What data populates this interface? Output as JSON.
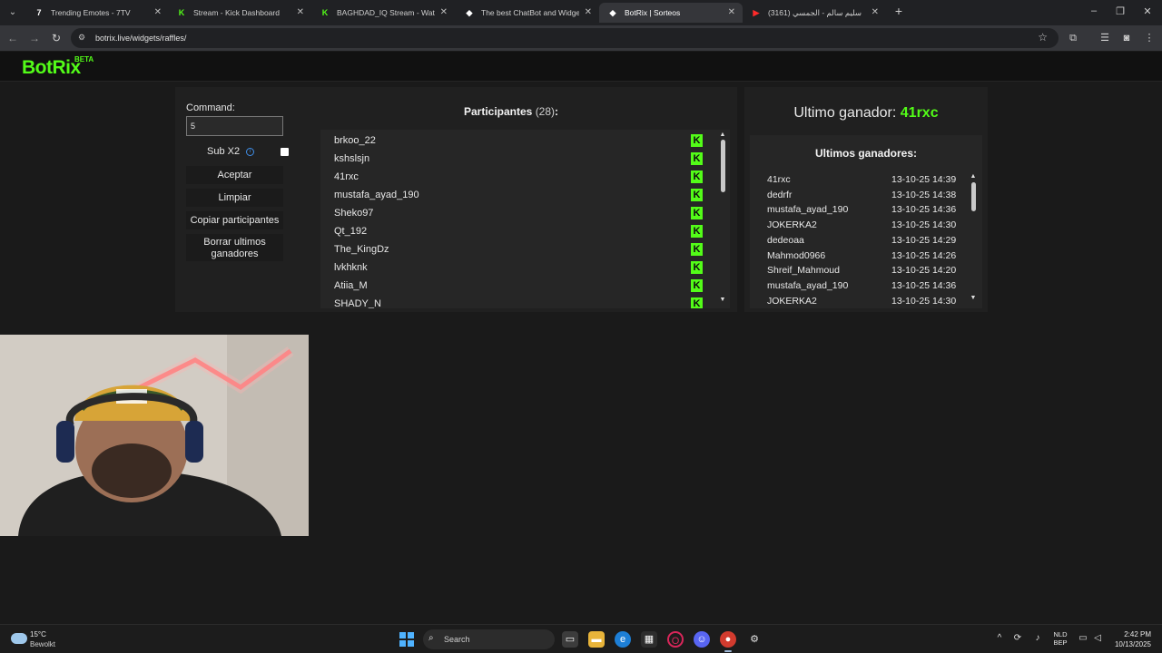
{
  "browser": {
    "tabs": [
      {
        "label": "Trending Emotes - 7TV",
        "icon": "7tv-icon",
        "icon_glyph": "7",
        "icon_color": "#ffffff",
        "active": false
      },
      {
        "label": "Stream - Kick Dashboard",
        "icon": "kick-icon",
        "icon_glyph": "K",
        "icon_color": "#53fc18",
        "active": false
      },
      {
        "label": "BAGHDAD_IQ Stream - Watch Live on Kick",
        "icon": "kick-icon",
        "icon_glyph": "K",
        "icon_color": "#53fc18",
        "active": false
      },
      {
        "label": "The best ChatBot and Widgets for Kick",
        "icon": "botrix-icon",
        "icon_glyph": "◆",
        "icon_color": "#ffffff",
        "active": false
      },
      {
        "label": "BotRix | Sorteos",
        "icon": "botrix-icon",
        "icon_glyph": "◆",
        "icon_color": "#ffffff",
        "active": true
      },
      {
        "label": "(3161) سليم سالم - الجمسي",
        "icon": "youtube-icon",
        "icon_glyph": "▶",
        "icon_color": "#ff2a2a",
        "active": false
      }
    ],
    "url": "botrix.live/widgets/raffles/"
  },
  "header": {
    "logo": "BotRix",
    "logo_badge": "BETA"
  },
  "controls": {
    "command_label": "Command:",
    "command_value": "5",
    "sub_label": "Sub X2",
    "sub_checked": false,
    "accept_button": "Aceptar",
    "clear_button": "Limpiar",
    "copy_button": "Copiar participantes",
    "delete_winners_button": "Borrar ultimos ganadores"
  },
  "participants": {
    "title": "Participantes",
    "count": "(28)",
    "colon": ":",
    "names": [
      "brkoo_22",
      "kshslsjn",
      "41rxc",
      "mustafa_ayad_190",
      "Sheko97",
      "Qt_192",
      "The_KingDz",
      "lvkhknk",
      "Atiia_M",
      "SHADY_N"
    ]
  },
  "winners": {
    "last_winner_label": "Ultimo ganador:",
    "last_winner_name": "41rxc",
    "list_title": "Ultimos ganadores:",
    "rows": [
      {
        "name": "41rxc",
        "date": "13-10-25 14:39"
      },
      {
        "name": "dedrfr",
        "date": "13-10-25 14:38"
      },
      {
        "name": "mustafa_ayad_190",
        "date": "13-10-25 14:36"
      },
      {
        "name": "JOKERKA2",
        "date": "13-10-25 14:30"
      },
      {
        "name": "dedeoaa",
        "date": "13-10-25 14:29"
      },
      {
        "name": "Mahmod0966",
        "date": "13-10-25 14:26"
      },
      {
        "name": "Shreif_Mahmoud",
        "date": "13-10-25 14:20"
      },
      {
        "name": "mustafa_ayad_190",
        "date": "13-10-25 14:36"
      },
      {
        "name": "JOKERKA2",
        "date": "13-10-25 14:30"
      }
    ]
  },
  "taskbar": {
    "temperature": "15°C",
    "weather": "Bewolkt",
    "search_placeholder": "Search",
    "lang_line1": "NLD",
    "lang_line2": "BEP",
    "time": "2:42 PM",
    "date": "10/13/2025"
  },
  "colors": {
    "accent": "#53fc18",
    "panel_bg": "#202020",
    "page_bg": "#1a1a1a"
  }
}
